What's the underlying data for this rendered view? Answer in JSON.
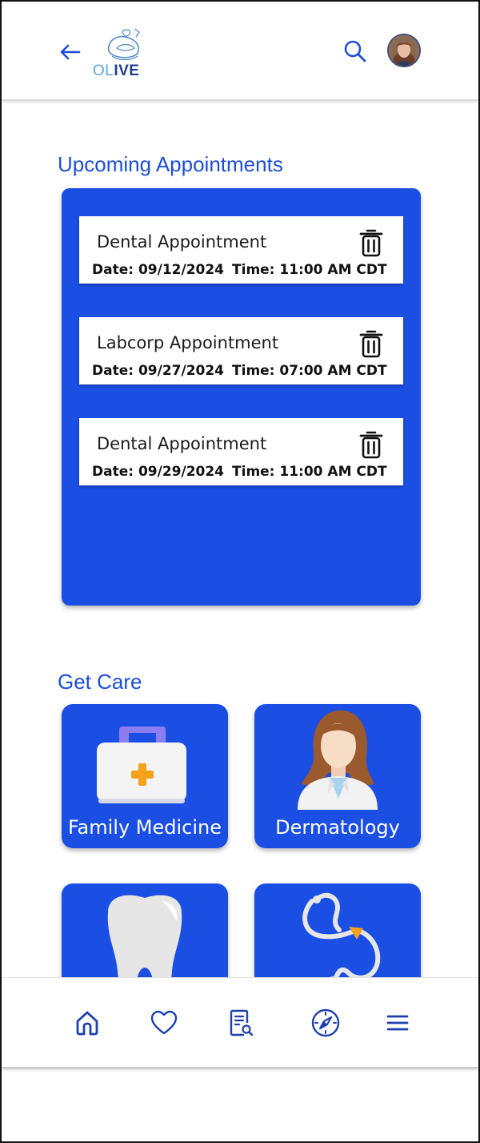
{
  "header": {
    "logo": {
      "text_light": "OL",
      "text_bold": "IVE"
    },
    "icons": {
      "back": "arrow-left-icon",
      "search": "search-icon",
      "avatar": "user-avatar"
    }
  },
  "upcoming": {
    "title": "Upcoming Appointments",
    "appointments": [
      {
        "title": "Dental Appointment",
        "date": "Date: 09/12/2024",
        "time": "Time: 11:00 AM CDT"
      },
      {
        "title": "Labcorp Appointment",
        "date": "Date: 09/27/2024",
        "time": "Time: 07:00 AM CDT"
      },
      {
        "title": "Dental Appointment",
        "date": "Date: 09/29/2024",
        "time": "Time: 11:00 AM CDT"
      }
    ]
  },
  "get_care": {
    "title": "Get Care",
    "tiles": [
      {
        "label": "Family Medicine",
        "icon": "first-aid-kit-icon"
      },
      {
        "label": "Dermatology",
        "icon": "doctor-icon"
      },
      {
        "label": "",
        "icon": "tooth-icon"
      },
      {
        "label": "",
        "icon": "stethoscope-icon"
      }
    ]
  },
  "bottom_nav": {
    "items": [
      "home-icon",
      "heart-icon",
      "records-search-icon",
      "compass-icon",
      "menu-icon"
    ]
  },
  "colors": {
    "primary_blue": "#1b4ee3",
    "title_blue": "#1d4ed8",
    "nav_blue": "#1e40af",
    "accent_orange": "#f59e0b"
  }
}
